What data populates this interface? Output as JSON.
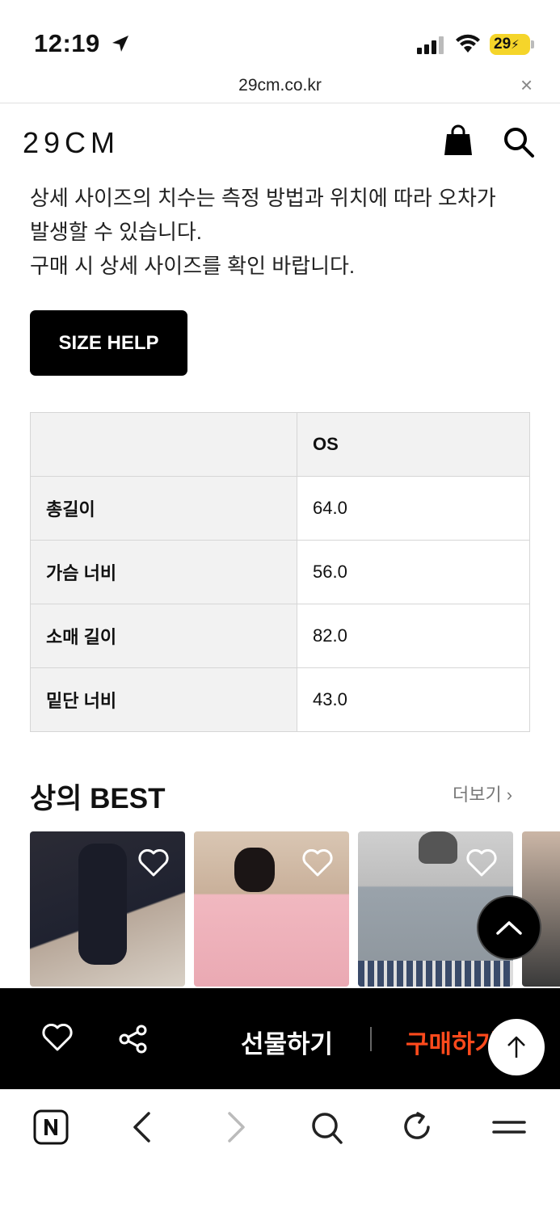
{
  "status_bar": {
    "time": "12:19",
    "battery": "29"
  },
  "browser": {
    "url": "29cm.co.kr",
    "close_glyph": "×"
  },
  "header": {
    "logo": "29CM"
  },
  "notice": {
    "line1": "상세 사이즈의 치수는 측정 방법과 위치에 따라 오차가",
    "line2": "발생할 수 있습니다.",
    "line3": "구매 시 상세 사이즈를 확인 바랍니다."
  },
  "size_help_label": "SIZE HELP",
  "size_table": {
    "header": [
      "",
      "OS"
    ],
    "rows": [
      {
        "label": "총길이",
        "value": "64.0"
      },
      {
        "label": "가슴 너비",
        "value": "56.0"
      },
      {
        "label": "소매 길이",
        "value": "82.0"
      },
      {
        "label": "밑단 너비",
        "value": "43.0"
      }
    ]
  },
  "best": {
    "title": "상의 BEST",
    "more": "더보기",
    "more_chevron": "›"
  },
  "bottom_bar": {
    "gift": "선물하기",
    "buy": "구매하기"
  },
  "colors": {
    "accent_buy": "#ff4a1c",
    "battery": "#f5d52a",
    "bar_bg": "#000000"
  },
  "icons": [
    "location-arrow-icon",
    "signal-icon",
    "wifi-icon",
    "battery-icon",
    "shopping-bag-icon",
    "search-icon",
    "heart-icon",
    "share-icon",
    "arrow-up-icon",
    "naver-icon",
    "back-icon",
    "forward-icon",
    "reload-icon",
    "menu-icon"
  ]
}
